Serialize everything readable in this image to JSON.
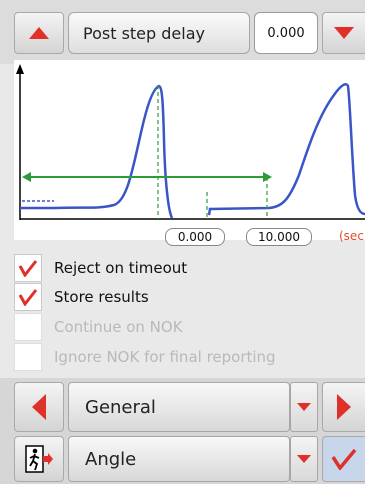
{
  "header": {
    "label": "Post step delay",
    "value": "0.000"
  },
  "graph": {
    "x_start": "0.000",
    "x_end": "10.000",
    "unit": "(sec"
  },
  "options": [
    {
      "label": "Reject on timeout",
      "checked": true,
      "enabled": true
    },
    {
      "label": "Store results",
      "checked": true,
      "enabled": true
    },
    {
      "label": "Continue on NOK",
      "checked": false,
      "enabled": false
    },
    {
      "label": "Ignore NOK for final reporting",
      "checked": false,
      "enabled": false
    }
  ],
  "category_selector": {
    "value": "General"
  },
  "mode_selector": {
    "value": "Angle"
  },
  "colors": {
    "accent_red": "#e0302a",
    "trace_blue": "#3a55c6",
    "marker_green": "#2e9b3a"
  }
}
